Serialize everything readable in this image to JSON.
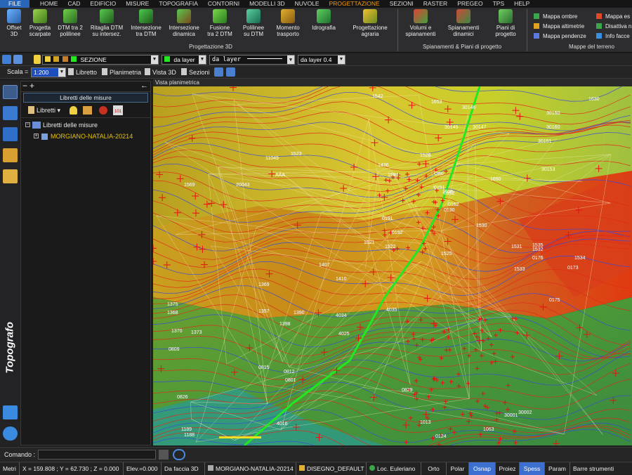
{
  "menu": [
    "FILE",
    "HOME",
    "CAD",
    "EDIFICIO",
    "MISURE",
    "TOPOGRAFIA",
    "CONTORNI",
    "MODELLI 3D",
    "NUVOLE",
    "PROGETTAZIONE",
    "SEZIONI",
    "RASTER",
    "PREGEO",
    "TPS",
    "HELP"
  ],
  "menu_active": "PROGETTAZIONE",
  "ribbon": {
    "buttons": [
      {
        "l1": "Offset",
        "l2": "3D"
      },
      {
        "l1": "Progetta",
        "l2": "scarpate"
      },
      {
        "l1": "DTM tra 2",
        "l2": "polilinee"
      },
      {
        "l1": "Ritaglia DTM",
        "l2": "su intersez."
      },
      {
        "l1": "Intersezione",
        "l2": "tra DTM"
      },
      {
        "l1": "Intersezione",
        "l2": "dinamica"
      },
      {
        "l1": "Fusione",
        "l2": "tra 2 DTM"
      },
      {
        "l1": "Polilinee",
        "l2": "su DTM"
      },
      {
        "l1": "Momento",
        "l2": "trasporto"
      },
      {
        "l1": "Idrografia",
        "l2": ""
      },
      {
        "l1": "Progettazione",
        "l2": "agraria"
      },
      {
        "l1": "Volumi e",
        "l2": "spianamenti"
      },
      {
        "l1": "Spianamenti",
        "l2": "dinamici"
      },
      {
        "l1": "Piani di",
        "l2": "progetto"
      }
    ],
    "group1": "Progettazione 3D",
    "group2": "Spianamenti & Piani di progetto",
    "group3": "Mappe del terreno",
    "terrain_col1": [
      "Mappa ombre",
      "Mappa altimetrie",
      "Mappa pendenze"
    ],
    "terrain_col2": [
      "Mappa es",
      "Disattiva n",
      "Info facce"
    ]
  },
  "toolbar1": {
    "layer_name": "SEZIONE",
    "color_value": "da layer",
    "linetype_value": "da layer",
    "lineweight_value": "da layer 0.4"
  },
  "toolbar2": {
    "scale_label": "Scala =",
    "scale_value": "1:200",
    "buttons": [
      "Libretto",
      "Planimetria",
      "Vista 3D",
      "Sezioni"
    ]
  },
  "panel": {
    "collapse": "−",
    "add": "+",
    "back": "←",
    "title": "Libretti delle misure",
    "libretti_button": "Libretti",
    "tree_root": "Libretti delle misure",
    "tree_child": "MORGIANO-NATALIA-20214"
  },
  "brand": "Topografo",
  "view": {
    "title": "Vista planimetrica",
    "labels": [
      {
        "t": "1542",
        "c": "w"
      },
      {
        "t": "30150",
        "c": "w"
      },
      {
        "t": "1630",
        "c": "w"
      },
      {
        "t": "1653",
        "c": "w"
      },
      {
        "t": "30146",
        "c": "w"
      },
      {
        "t": "30147",
        "c": "w"
      },
      {
        "t": "30145",
        "c": "w"
      },
      {
        "t": "30151",
        "c": "w"
      },
      {
        "t": "30153",
        "c": "w"
      },
      {
        "t": "1650",
        "c": "w"
      },
      {
        "t": "1523",
        "c": "w"
      },
      {
        "t": "11049",
        "c": "w"
      },
      {
        "t": "AAA",
        "c": "w"
      },
      {
        "t": "20043",
        "c": "w"
      },
      {
        "t": "1569",
        "c": "w"
      },
      {
        "t": "1436",
        "c": "w"
      },
      {
        "t": "1584",
        "c": "w"
      },
      {
        "t": "1528",
        "c": "w"
      },
      {
        "t": "1526",
        "c": "w"
      },
      {
        "t": "1530",
        "c": "w"
      },
      {
        "t": "1521",
        "c": "w"
      },
      {
        "t": "1522",
        "c": "w"
      },
      {
        "t": "1525",
        "c": "w"
      },
      {
        "t": "1531",
        "c": "w"
      },
      {
        "t": "1532",
        "c": "w"
      },
      {
        "t": "1533",
        "c": "w"
      },
      {
        "t": "1534",
        "c": "w"
      },
      {
        "t": "1407",
        "c": "w"
      },
      {
        "t": "1410",
        "c": "w"
      },
      {
        "t": "1369",
        "c": "w"
      },
      {
        "t": "1368",
        "c": "w"
      },
      {
        "t": "1375",
        "c": "w"
      },
      {
        "t": "1370",
        "c": "w"
      },
      {
        "t": "1373",
        "c": "w"
      },
      {
        "t": "1357",
        "c": "w"
      },
      {
        "t": "1390",
        "c": "w"
      },
      {
        "t": "1398",
        "c": "w"
      },
      {
        "t": "4034",
        "c": "w"
      },
      {
        "t": "4035",
        "c": "w"
      },
      {
        "t": "4025",
        "c": "w"
      },
      {
        "t": "0809",
        "c": "w"
      },
      {
        "t": "0815",
        "c": "w"
      },
      {
        "t": "0812",
        "c": "w"
      },
      {
        "t": "0801",
        "c": "w"
      },
      {
        "t": "0826",
        "c": "w"
      },
      {
        "t": "0829",
        "c": "w"
      },
      {
        "t": "1188",
        "c": "w"
      },
      {
        "t": "4016",
        "c": "w"
      },
      {
        "t": "1189",
        "c": "w"
      },
      {
        "t": "1063",
        "c": "w"
      },
      {
        "t": "30001",
        "c": "w"
      },
      {
        "t": "30002",
        "c": "w"
      },
      {
        "t": "1013",
        "c": "w"
      },
      {
        "t": "0124",
        "c": "w"
      },
      {
        "t": "0175",
        "c": "w"
      },
      {
        "t": "0173",
        "c": "w"
      },
      {
        "t": "0176",
        "c": "w"
      },
      {
        "t": "0192",
        "c": "w"
      },
      {
        "t": "0191",
        "c": "w"
      },
      {
        "t": "0130",
        "c": "w"
      },
      {
        "t": "Orto",
        "c": "w"
      },
      {
        "t": "0152",
        "c": "w"
      },
      {
        "t": "0151",
        "c": "w"
      },
      {
        "t": "0162",
        "c": "w"
      },
      {
        "t": "1535",
        "c": "w"
      },
      {
        "t": "30160",
        "c": "w"
      }
    ]
  },
  "command": {
    "label": "Comando :",
    "value": ""
  },
  "status": [
    {
      "t": "Metri",
      "on": false
    },
    {
      "t": "X = 159.808 ; Y = 62.730 ; Z = 0.000",
      "on": false
    },
    {
      "t": "Elev.=0.000",
      "on": false
    },
    {
      "t": "Da faccia 3D",
      "on": false
    },
    {
      "t": "MORGIANO-NATALIA-20214",
      "on": false
    },
    {
      "t": "DISEGNO_DEFAULT",
      "on": false
    },
    {
      "t": "Loc. Euleriano",
      "on": false
    },
    {
      "t": "Orto",
      "on": false
    },
    {
      "t": "Polar",
      "on": false
    },
    {
      "t": "Osnap",
      "on": true
    },
    {
      "t": "Proiez",
      "on": false
    },
    {
      "t": "Spess",
      "on": true
    },
    {
      "t": "Param",
      "on": false
    },
    {
      "t": "Barre strumenti",
      "on": false
    }
  ],
  "colors": {
    "accent": "#ff9a00",
    "selected_tree": "#e8c400",
    "status_on": "#3c6fd0",
    "alignment_line": "#22e822"
  }
}
